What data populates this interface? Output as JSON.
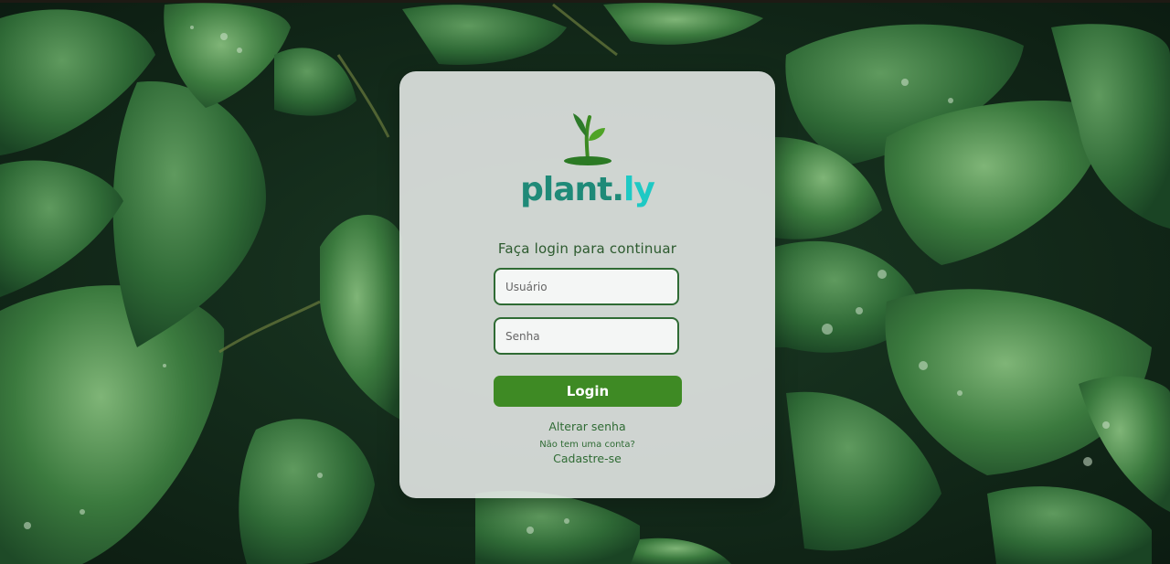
{
  "brand": {
    "part1": "plant.",
    "part2": "ly",
    "primary_color": "#1f8a78",
    "accent_color": "#1ec9c4",
    "logo_icon": "sprout-icon"
  },
  "login": {
    "title": "Faça login para continuar",
    "username_placeholder": "Usuário",
    "username_value": "",
    "password_placeholder": "Senha",
    "password_value": "",
    "submit_label": "Login",
    "change_password_label": "Alterar senha",
    "no_account_text": "Não tem uma conta?",
    "signup_label": "Cadastre-se"
  },
  "colors": {
    "button": "#3e8a24",
    "text_green": "#2c5a2e",
    "field_border": "#2f6b34"
  },
  "background": {
    "description_icon": "leaves-background-image"
  }
}
